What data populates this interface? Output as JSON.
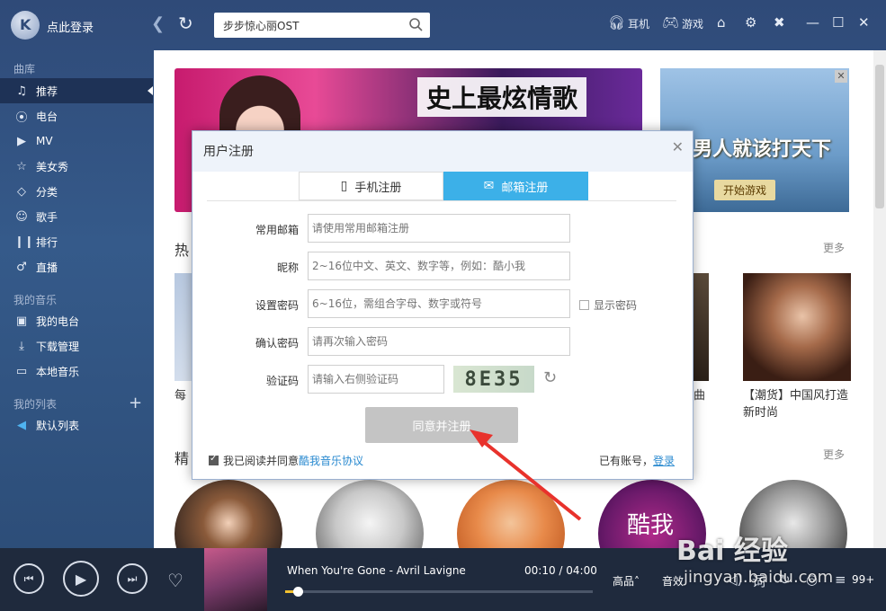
{
  "topbar": {
    "login": "点此登录",
    "search_value": "步步惊心丽OST",
    "earphone": "耳机",
    "game": "游戏"
  },
  "sidebar": {
    "library_title": "曲库",
    "library_items": [
      {
        "label": "推荐",
        "icon": "music-note-icon"
      },
      {
        "label": "电台",
        "icon": "radio-icon"
      },
      {
        "label": "MV",
        "icon": "mv-icon"
      },
      {
        "label": "美女秀",
        "icon": "star-icon"
      },
      {
        "label": "分类",
        "icon": "tag-icon"
      },
      {
        "label": "歌手",
        "icon": "person-icon"
      },
      {
        "label": "排行",
        "icon": "chart-bars-icon"
      },
      {
        "label": "直播",
        "icon": "microphone-icon"
      }
    ],
    "mymusic_title": "我的音乐",
    "mymusic_items": [
      {
        "label": "我的电台",
        "icon": "radio-box-icon"
      },
      {
        "label": "下载管理",
        "icon": "download-icon"
      },
      {
        "label": "本地音乐",
        "icon": "monitor-icon"
      }
    ],
    "mylist_title": "我的列表",
    "mylist_items": [
      {
        "label": "默认列表",
        "icon": "speaker-icon"
      }
    ]
  },
  "main": {
    "banner_title": "史上最炫情歌",
    "ad_text": "男人就该打天下",
    "ad_button": "开始游戏",
    "hot_label": "热",
    "hot_more": "更多",
    "card_left_text": "每",
    "card_mid_text": "曲",
    "card_right_text": "【潮货】中国风打造新时尚",
    "fine_label": "精",
    "fine_more": "更多",
    "circle_text": "酷我"
  },
  "dialog": {
    "title": "用户注册",
    "tab_phone": "手机注册",
    "tab_email": "邮箱注册",
    "fields": [
      {
        "label": "常用邮箱",
        "placeholder": "请使用常用邮箱注册"
      },
      {
        "label": "昵称",
        "placeholder": "2~16位中文、英文、数字等，例如：酷小我"
      },
      {
        "label": "设置密码",
        "placeholder": "6~16位，需组合字母、数字或符号"
      },
      {
        "label": "确认密码",
        "placeholder": "请再次输入密码"
      },
      {
        "label": "验证码",
        "placeholder": "请输入右侧验证码"
      }
    ],
    "show_password": "显示密码",
    "captcha": "8E35",
    "submit": "同意并注册",
    "agree_prefix": "我已阅读并同意",
    "agree_link": "酷我音乐协议",
    "has_account": "已有账号，",
    "login_link": "登录"
  },
  "player": {
    "song": "When You're Gone - Avril Lavigne",
    "time": "00:10 / 04:00",
    "progress": 0.04,
    "quality": "高品",
    "effect": "音效",
    "lyrics": "词",
    "count": "99+"
  },
  "watermark": {
    "brand": "Bai 经验",
    "url": "jingyan.baidu.com"
  },
  "colors": {
    "accent": "#3cb0e8",
    "sidebar_bg": "#2f4a78",
    "player_bg": "#1f2a3d"
  }
}
